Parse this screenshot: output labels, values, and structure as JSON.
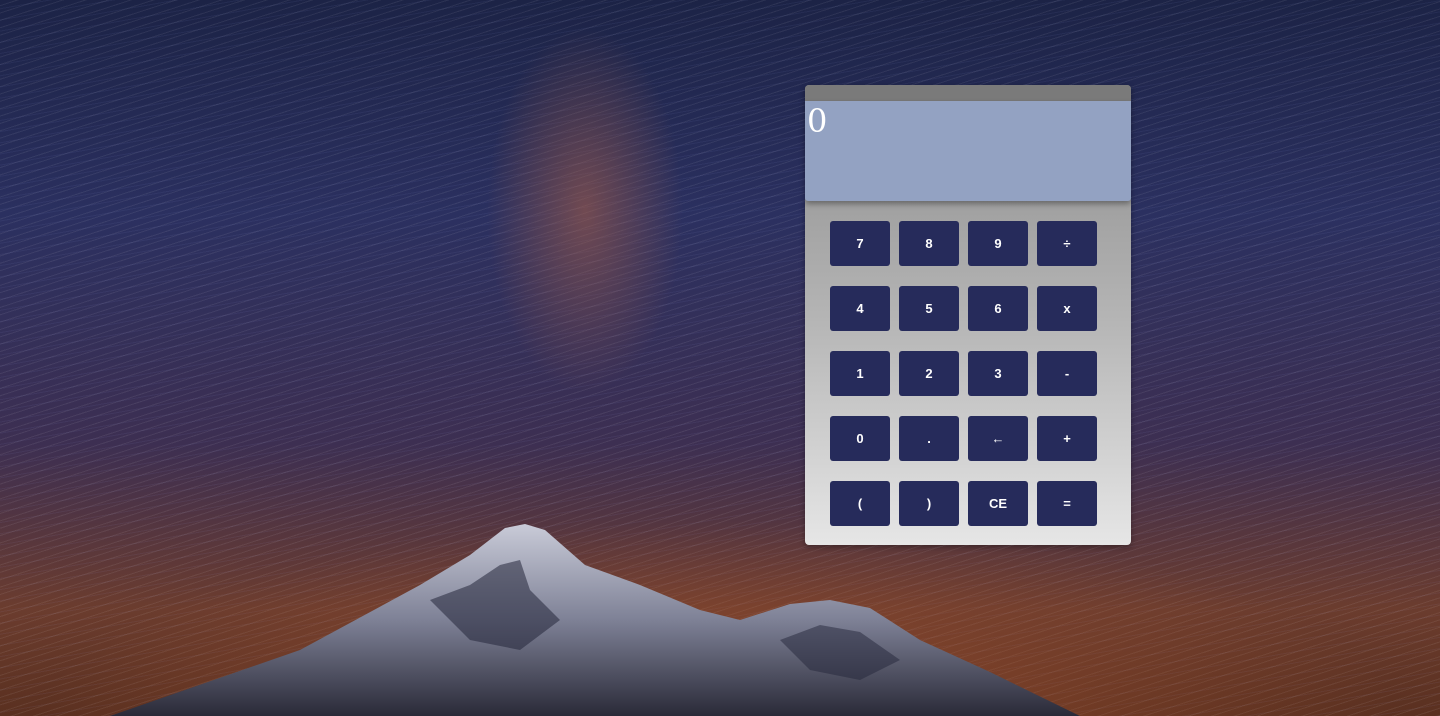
{
  "display": {
    "value": "0"
  },
  "keypad": {
    "rows": [
      [
        {
          "label": "7",
          "name": "key-7"
        },
        {
          "label": "8",
          "name": "key-8"
        },
        {
          "label": "9",
          "name": "key-9"
        },
        {
          "label": "÷",
          "name": "key-divide"
        }
      ],
      [
        {
          "label": "4",
          "name": "key-4"
        },
        {
          "label": "5",
          "name": "key-5"
        },
        {
          "label": "6",
          "name": "key-6"
        },
        {
          "label": "x",
          "name": "key-multiply"
        }
      ],
      [
        {
          "label": "1",
          "name": "key-1"
        },
        {
          "label": "2",
          "name": "key-2"
        },
        {
          "label": "3",
          "name": "key-3"
        },
        {
          "label": "-",
          "name": "key-subtract"
        }
      ],
      [
        {
          "label": "0",
          "name": "key-0"
        },
        {
          "label": ".",
          "name": "key-decimal"
        },
        {
          "label": "←",
          "name": "key-backspace"
        },
        {
          "label": "+",
          "name": "key-add"
        }
      ],
      [
        {
          "label": "(",
          "name": "key-open-paren"
        },
        {
          "label": ")",
          "name": "key-close-paren"
        },
        {
          "label": "CE",
          "name": "key-clear-entry"
        },
        {
          "label": "=",
          "name": "key-equals"
        }
      ]
    ]
  },
  "theme": {
    "key_color": "#262b5b",
    "display_color": "#93a2c2",
    "titlebar_color": "#7a7a7a"
  }
}
